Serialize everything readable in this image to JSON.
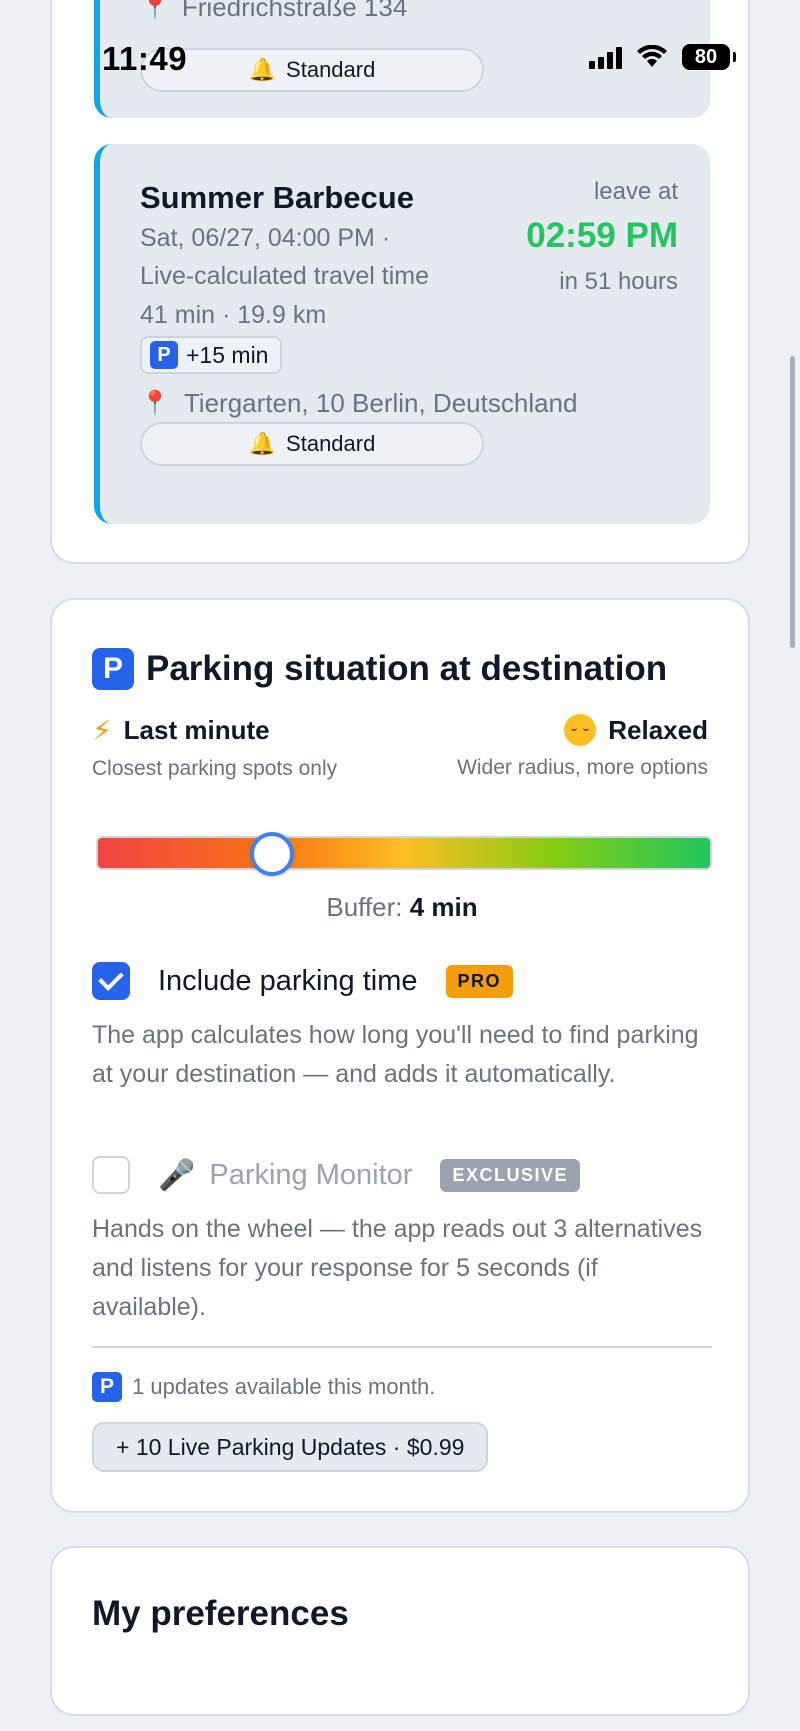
{
  "status_bar": {
    "time": "11:49",
    "battery": "80"
  },
  "events": [
    {
      "address_partial": "Friedrichstraße 134",
      "reminder": "Standard"
    },
    {
      "title": "Summer Barbecue",
      "date": "Sat, 06/27, 04:00 PM ·",
      "travel_note": "Live-calculated travel time",
      "duration_distance": "41 min · 19.9 km",
      "parking_extra": "+15 min",
      "address": "Tiergarten, 10 Berlin, Deutschland",
      "reminder": "Standard",
      "leave_label": "leave at",
      "leave_time": "02:59 PM",
      "leave_relative": "in 51 hours"
    }
  ],
  "parking": {
    "icon_letter": "P",
    "title": "Parking situation at destination",
    "mode_left": {
      "label": "Last minute",
      "desc": "Closest parking spots only",
      "icon": "lightning-bolt-icon"
    },
    "mode_right": {
      "label": "Relaxed",
      "desc": "Wider radius, more options",
      "icon": "relieved-face-icon"
    },
    "slider_fraction": 0.285,
    "buffer_label": "Buffer:",
    "buffer_value": "4 min",
    "include_parking": {
      "label": "Include parking time",
      "badge": "PRO",
      "checked": true,
      "desc": "The app calculates how long you'll need to find parking at your destination — and adds it automatically."
    },
    "monitor": {
      "label": "Parking Monitor",
      "badge": "EXCLUSIVE",
      "checked": false,
      "icon": "microphone-icon",
      "desc": "Hands on the wheel — the app reads out 3 alternatives and listens for your response for 5 seconds (if available)."
    },
    "updates_text": "1 updates available this month.",
    "buy_button": "+ 10 Live Parking Updates · $0.99"
  },
  "preferences": {
    "title": "My preferences"
  },
  "colors": {
    "accent": "#2563eb",
    "leave_time": "#22c55e",
    "pro": "#f59e0b",
    "event_bar": "#0ea5e9"
  }
}
